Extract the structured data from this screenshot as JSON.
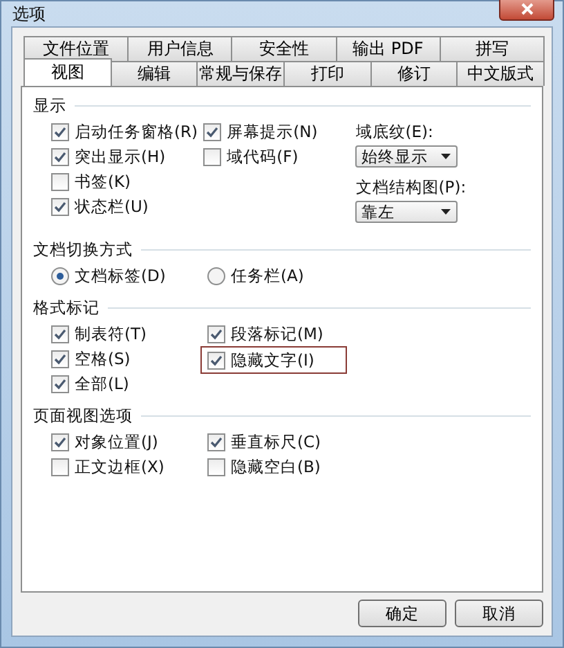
{
  "window": {
    "title": "选项"
  },
  "tab_rows": [
    [
      {
        "label": "文件位置",
        "selected": false
      },
      {
        "label": "用户信息",
        "selected": false
      },
      {
        "label": "安全性",
        "selected": false
      },
      {
        "label": "输出 PDF",
        "selected": false
      },
      {
        "label": "拼写",
        "selected": false
      }
    ],
    [
      {
        "label": "视图",
        "selected": true
      },
      {
        "label": "编辑",
        "selected": false
      },
      {
        "label": "常规与保存",
        "selected": false
      },
      {
        "label": "打印",
        "selected": false
      },
      {
        "label": "修订",
        "selected": false
      },
      {
        "label": "中文版式",
        "selected": false
      }
    ]
  ],
  "sections": [
    {
      "title": "显示",
      "columns": [
        [
          {
            "kind": "checkbox",
            "label": "启动任务窗格(R)",
            "checked": true
          },
          {
            "kind": "checkbox",
            "label": "突出显示(H)",
            "checked": true
          },
          {
            "kind": "checkbox",
            "label": "书签(K)",
            "checked": false
          },
          {
            "kind": "checkbox",
            "label": "状态栏(U)",
            "checked": true
          }
        ],
        [
          {
            "kind": "checkbox",
            "label": "屏幕提示(N)",
            "checked": true
          },
          {
            "kind": "checkbox",
            "label": "域代码(F)",
            "checked": false
          }
        ],
        [
          {
            "kind": "dropdown",
            "label": "域底纹(E):",
            "value": "始终显示"
          },
          {
            "kind": "dropdown",
            "label": "文档结构图(P):",
            "value": "靠左"
          }
        ]
      ]
    },
    {
      "title": "文档切换方式",
      "columns": [
        [
          {
            "kind": "radio",
            "label": "文档标签(D)",
            "selected": true
          }
        ],
        [
          {
            "kind": "radio",
            "label": "任务栏(A)",
            "selected": false
          }
        ]
      ]
    },
    {
      "title": "格式标记",
      "columns": [
        [
          {
            "kind": "checkbox",
            "label": "制表符(T)",
            "checked": true
          },
          {
            "kind": "checkbox",
            "label": "空格(S)",
            "checked": true
          },
          {
            "kind": "checkbox",
            "label": "全部(L)",
            "checked": true
          }
        ],
        [
          {
            "kind": "checkbox",
            "label": "段落标记(M)",
            "checked": true
          },
          {
            "kind": "checkbox",
            "label": "隐藏文字(I)",
            "checked": true,
            "highlighted": true
          }
        ]
      ]
    },
    {
      "title": "页面视图选项",
      "columns": [
        [
          {
            "kind": "checkbox",
            "label": "对象位置(J)",
            "checked": true
          },
          {
            "kind": "checkbox",
            "label": "正文边框(X)",
            "checked": false
          }
        ],
        [
          {
            "kind": "checkbox",
            "label": "垂直标尺(C)",
            "checked": true
          },
          {
            "kind": "checkbox",
            "label": "隐藏空白(B)",
            "checked": false
          }
        ]
      ]
    }
  ],
  "buttons": [
    "确定",
    "取消"
  ]
}
